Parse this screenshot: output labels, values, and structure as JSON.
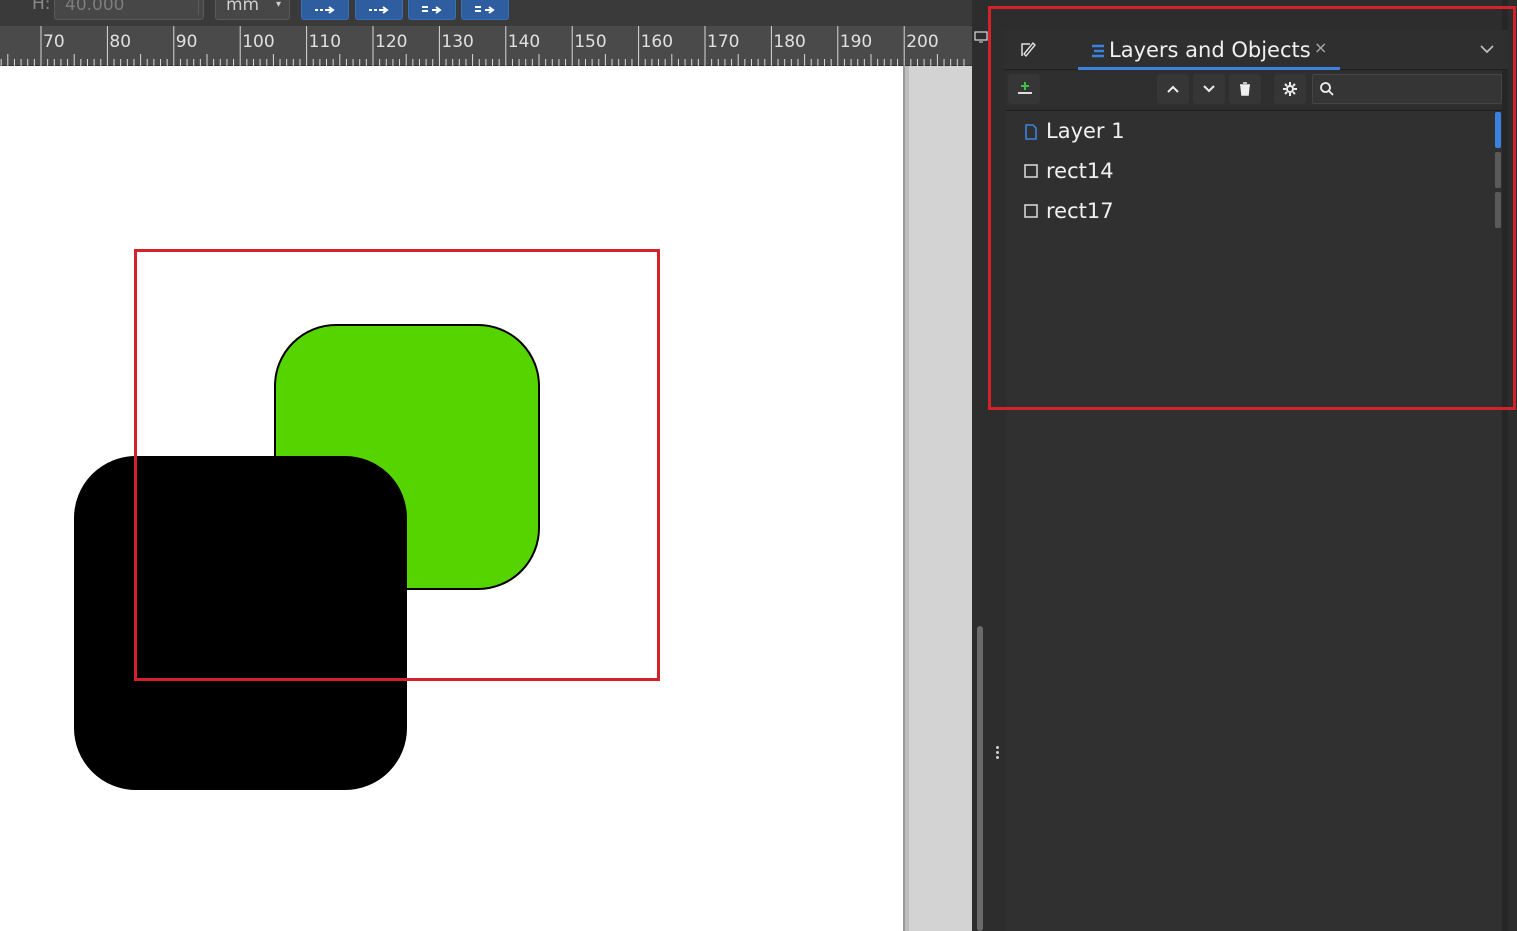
{
  "toolbar": {
    "height_label": "H:",
    "height_value": "40.000",
    "unit": "mm",
    "buttons": [
      "move-icon",
      "move-icon",
      "move-icon",
      "move-icon"
    ]
  },
  "ruler": {
    "ticks": [
      "70",
      "80",
      "90",
      "100",
      "110",
      "120",
      "130",
      "140",
      "150",
      "160",
      "170",
      "180",
      "190",
      "200"
    ]
  },
  "canvas": {
    "objects": [
      {
        "id": "rect14",
        "fill": "#55d400"
      },
      {
        "id": "rect17",
        "fill": "#000000"
      }
    ]
  },
  "dock": {
    "tab_label": "Layers and Objects",
    "tab_close": "×",
    "search_placeholder": "",
    "tree": [
      {
        "label": "Layer 1",
        "kind": "layer"
      },
      {
        "label": "rect14",
        "kind": "object"
      },
      {
        "label": "rect17",
        "kind": "object"
      }
    ]
  },
  "colors": {
    "accent": "#3b82e0",
    "highlight": "#d4222a",
    "panel_bg": "#2d2d2d"
  }
}
